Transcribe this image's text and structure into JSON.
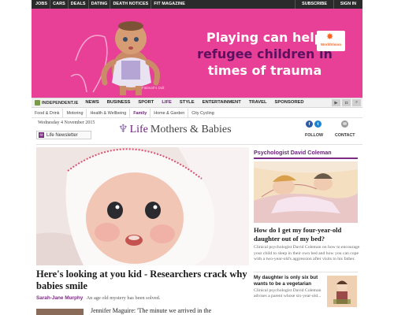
{
  "topbar": {
    "links": [
      "JOBS",
      "CARS",
      "DEALS",
      "DATING",
      "DEATH NOTICES",
      "FIT MAGAZINE"
    ],
    "subscribe": "SUBSCRIBE",
    "signin": "SIGN IN"
  },
  "ad": {
    "line1": "Playing can help",
    "line2": "refugee children in",
    "line3": "times of trauma",
    "credit": "Fatimah's Doll",
    "logo_text": "WorldVision"
  },
  "nav": {
    "brand": "INDEPENDENT.IE",
    "items": [
      "NEWS",
      "BUSINESS",
      "SPORT",
      "LIFE",
      "STYLE",
      "ENTERTAINMENT",
      "TRAVEL",
      "SPONSORED"
    ],
    "active": "LIFE"
  },
  "subnav": {
    "items": [
      "Food & Drink",
      "Motoring",
      "Health & Wellbeing",
      "Family",
      "Home & Garden",
      "City Cycling"
    ],
    "active": "Family"
  },
  "date": "Wednesday 4 November 2015",
  "newsletter": {
    "label": "Life Newsletter"
  },
  "section": {
    "life": "Life",
    "name": "Mothers & Babies"
  },
  "social": {
    "follow": "FOLLOW",
    "contact": "CONTACT"
  },
  "main_story": {
    "headline": "Here's looking at you kid - Researchers crack why babies smile",
    "author": "Sarah-Jane Murphy",
    "teaser": "An age old mystery has been solved."
  },
  "next_story": {
    "title": "Jennifer Maguire: 'The minute we arrived in the"
  },
  "right_column": {
    "heading": "Psychologist David Coleman",
    "story1_title": "How do I get my four-year-old daughter out of my bed?",
    "story1_desc": "Clinical psychologist David Coleman on how to encourage your child to sleep in their own bed and how you can cope with a two-year-old's aggression after visits to his father.",
    "story2_title": "My daughter is only six but wants to be a vegetarian",
    "story2_desc": "Clinical psychologist David Coleman advises a parent whose six-year-old..."
  },
  "colors": {
    "accent": "#7b2c82",
    "ad_pink": "#e83f97",
    "topbar": "#2b2b2b"
  }
}
